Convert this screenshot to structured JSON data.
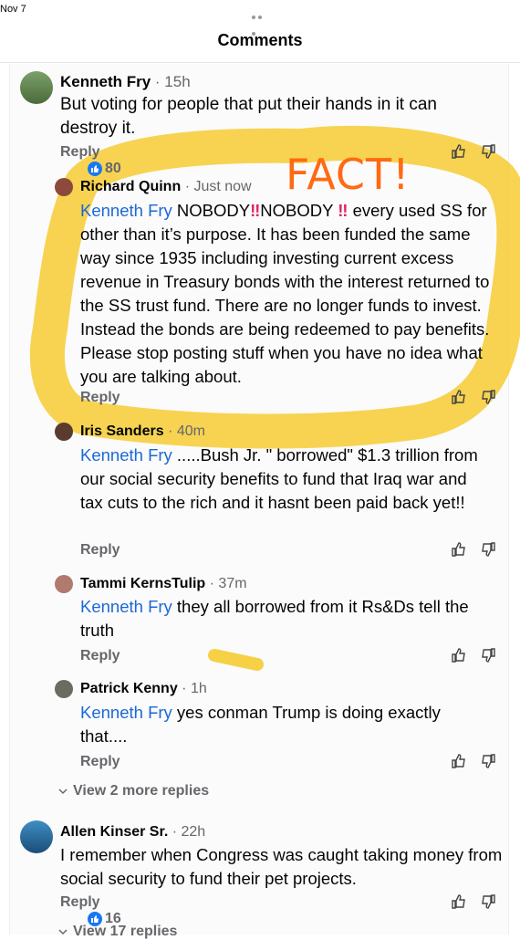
{
  "status": {
    "date": "Nov 7"
  },
  "header": {
    "title": "Comments"
  },
  "annotation": {
    "overlay_text": "FACT!",
    "highlight_color": "#f5c518",
    "text_color": "#ff6a13"
  },
  "comments": [
    {
      "author": "Kenneth Fry",
      "time": "· 15h",
      "text": "But voting for people that put their hands in it can destroy it.",
      "reply_label": "Reply",
      "reactions": "80"
    },
    {
      "author": "Richard Quinn",
      "time": "· Just now",
      "mention": "Kenneth Fry",
      "pre": " NOBODY",
      "bang1": "‼",
      "mid": "NOBODY ",
      "bang2": "‼",
      "text": " every used SS for other than it’s purpose. It has been funded the same way since 1935 including investing current excess revenue in Treasury bonds with the interest returned to the SS trust fund. There are no longer funds to invest. Instead the bonds are being redeemed to pay benefits. Please stop posting stuff when you have no idea what you are talking about.",
      "reply_label": "Reply"
    },
    {
      "author": "Iris Sanders",
      "time": "· 40m",
      "mention": "Kenneth Fry",
      "text": " .....Bush Jr. \" borrowed\" $1.3 trillion from our social security benefits to fund that Iraq war and tax cuts to the rich and it hasnt been paid back yet!!",
      "reply_label": "Reply"
    },
    {
      "author": "Tammi KernsTulip",
      "time": "· 37m",
      "mention": "Kenneth Fry",
      "text": " they all borrowed from it Rs&Ds tell the truth",
      "reply_label": "Reply"
    },
    {
      "author": "Patrick Kenny",
      "time": "· 1h",
      "mention": "Kenneth Fry",
      "text": " yes conman Trump is doing exactly that....",
      "reply_label": "Reply"
    },
    {
      "author": "Allen Kinser Sr.",
      "time": "· 22h",
      "text": "I remember when Congress was caught taking money from social security to fund their pet projects.",
      "reply_label": "Reply",
      "reactions": "16"
    }
  ],
  "view_more": {
    "label": "View 2 more replies"
  },
  "view_more_bottom": {
    "label": "View 17 replies"
  },
  "icons": {
    "like": "thumbs-up-icon",
    "dislike": "thumbs-down-icon",
    "chevron": "chevron-down-icon"
  },
  "colors": {
    "mention": "#1b69d6",
    "reaction": "#1877f2"
  }
}
